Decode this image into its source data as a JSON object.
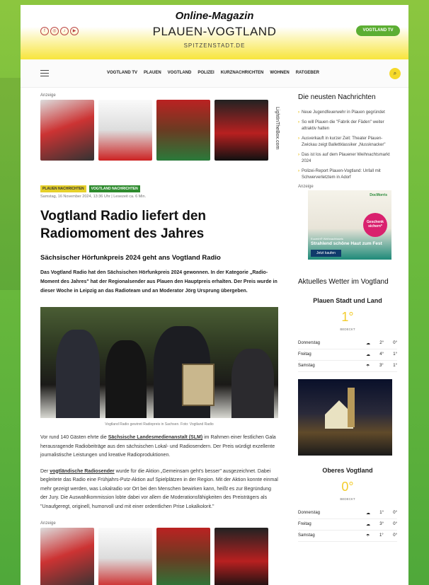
{
  "header": {
    "brand_line1": "Online-Magazin",
    "brand_line2": "PLAUEN-VOGTLAND",
    "brand_line3": "SPITZENSTADT.DE",
    "tv_button": "VOGTLAND TV",
    "social_icons": [
      "facebook-icon",
      "instagram-icon",
      "tiktok-icon",
      "youtube-icon"
    ]
  },
  "nav": {
    "items": [
      "VOGTLAND TV",
      "PLAUEN",
      "VOGTLAND",
      "POLIZEI",
      "KURZNACHRICHTEN",
      "WOHNEN",
      "RATGEBER"
    ]
  },
  "ad": {
    "label": "Anzeige",
    "vertical_text": "LightInTheBox.com"
  },
  "article": {
    "tags": [
      "PLAUEN NACHRICHTEN",
      "VOGTLAND NACHRICHTEN"
    ],
    "meta": "Samstag, 16 November 2024, 13:36 Uhr | Lesezeit ca. 6 Min.",
    "title": "Vogtland Radio liefert den Radiomoment des Jahres",
    "subtitle": "Sächsischer Hörfunkpreis 2024 geht ans Vogtland Radio",
    "lead": "Das Vogtland Radio hat den Sächsischen Hörfunkpreis 2024 gewonnen. In der Kategorie „Radio-Moment des Jahres\" hat der Regionalsender aus Plauen den Hauptpreis erhalten. Der Preis wurde in dieser Woche in Leipzig an das Radioteam und an Moderator Jörg Ursprung übergeben.",
    "caption": "Vogtland Radio gewinnt Radiopreis in Sachsen. Foto: Vogtland Radio",
    "p1_before": "Vor rund 140 Gästen ehrte die ",
    "p1_link": "Sächsische Landesmedienanstalt (SLM)",
    "p1_after": " im Rahmen einer festlichen Gala herausragende Radiobeiträge aus den sächsischen Lokal- und Radiosendern. Der Preis würdigt exzellente journalistische Leistungen und kreative Radioproduktionen.",
    "p2_before": "Der ",
    "p2_link": "vogtländische Radiosender",
    "p2_after": " wurde für die Aktion „Gemeinsam geht's besser\" ausgezeichnet. Dabei begleitete das Radio eine Frühjahrs-Putz-Aktion auf Spielplätzen in der Region. Mit der Aktion konnte einmal mehr gezeigt werden, was Lokalradio vor Ort bei den Menschen bewirken kann, heißt es zur Begründung der Jury. Die Auswahlkommission lobte dabei vor allem die Moderationsfähigkeiten des Preisträgers als \"Unaufgeregt, originell, humorvoll und mit einer ordentlichen Prise Lokalkolorit.\"",
    "ad_label2": "Anzeige"
  },
  "sidebar": {
    "news_title": "Die neusten Nachrichten",
    "news": [
      "Neue Jugendfeuerwehr in Plauen gegründet",
      "So will Plauen die \"Fabrik der Fäden\" weiter attraktiv halten",
      "Ausverkauft in kurzer Zeit: Theater Plauen-Zwickau zeigt Ballettklassiker „Nussknacker\"",
      "Das ist los auf dem Plauener Weihnachtsmarkt 2024",
      "Polizei-Report Plauen-Vogtland: Unfall mit Schwerverletztem in Adorf"
    ],
    "ad_label": "Anzeige",
    "ad_brand": "DocMorris",
    "ad_badge": "Geschenk sichern*",
    "ad_line1": "Eucerin® Weihnachtssets",
    "ad_line2": "Strahlend schöne Haut zum Fest",
    "ad_button": "Jetzt kaufen",
    "weather_title": "Aktuelles Wetter im Vogtland",
    "w1": {
      "location": "Plauen Stadt und Land",
      "temp": "1°",
      "desc": "BEDECKT",
      "rows": [
        {
          "day": "Donnerstag",
          "hi": "2°",
          "lo": "0°"
        },
        {
          "day": "Freitag",
          "hi": "4°",
          "lo": "1°"
        },
        {
          "day": "Samstag",
          "hi": "3°",
          "lo": "1°"
        }
      ]
    },
    "w2": {
      "location": "Oberes Vogtland",
      "temp": "0°",
      "desc": "BEDECKT",
      "rows": [
        {
          "day": "Donnerstag",
          "hi": "1°",
          "lo": "0°"
        },
        {
          "day": "Freitag",
          "hi": "3°",
          "lo": "0°"
        },
        {
          "day": "Samstag",
          "hi": "1°",
          "lo": "0°"
        }
      ]
    }
  }
}
